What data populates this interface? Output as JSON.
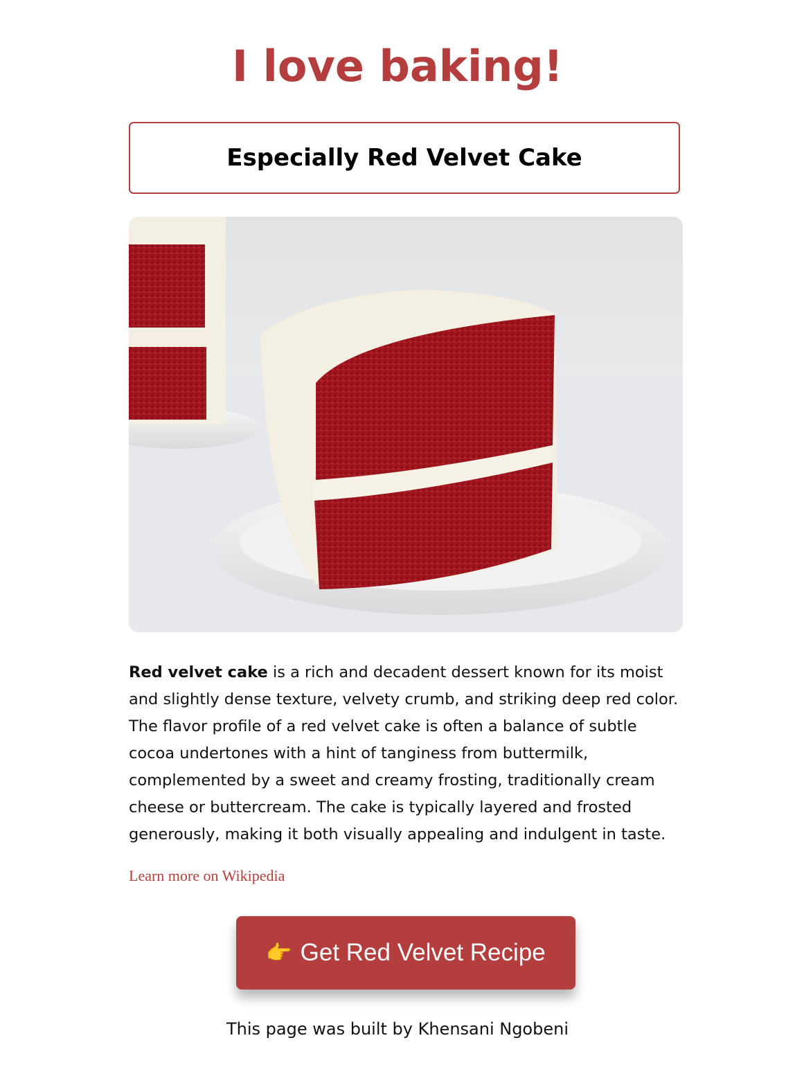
{
  "header": {
    "title": "I love baking!",
    "subtitle": "Especially Red Velvet Cake"
  },
  "description": {
    "bold_lead": "Red velvet cake",
    "body": " is a rich and decadent dessert known for its moist and slightly dense texture, velvety crumb, and striking deep red color. The flavor profile of a red velvet cake is often a balance of subtle cocoa undertones with a hint of tanginess from buttermilk, complemented by a sweet and creamy frosting, traditionally cream cheese or buttercream. The cake is typically layered and frosted generously, making it both visually appealing and indulgent in taste."
  },
  "links": {
    "wikipedia_label": "Learn more on Wikipedia"
  },
  "cta": {
    "icon": "👉",
    "label": "Get Red Velvet Recipe"
  },
  "footer": {
    "credit": "This page was built by Khensani Ngobeni"
  },
  "colors": {
    "accent": "#b43d3d"
  }
}
